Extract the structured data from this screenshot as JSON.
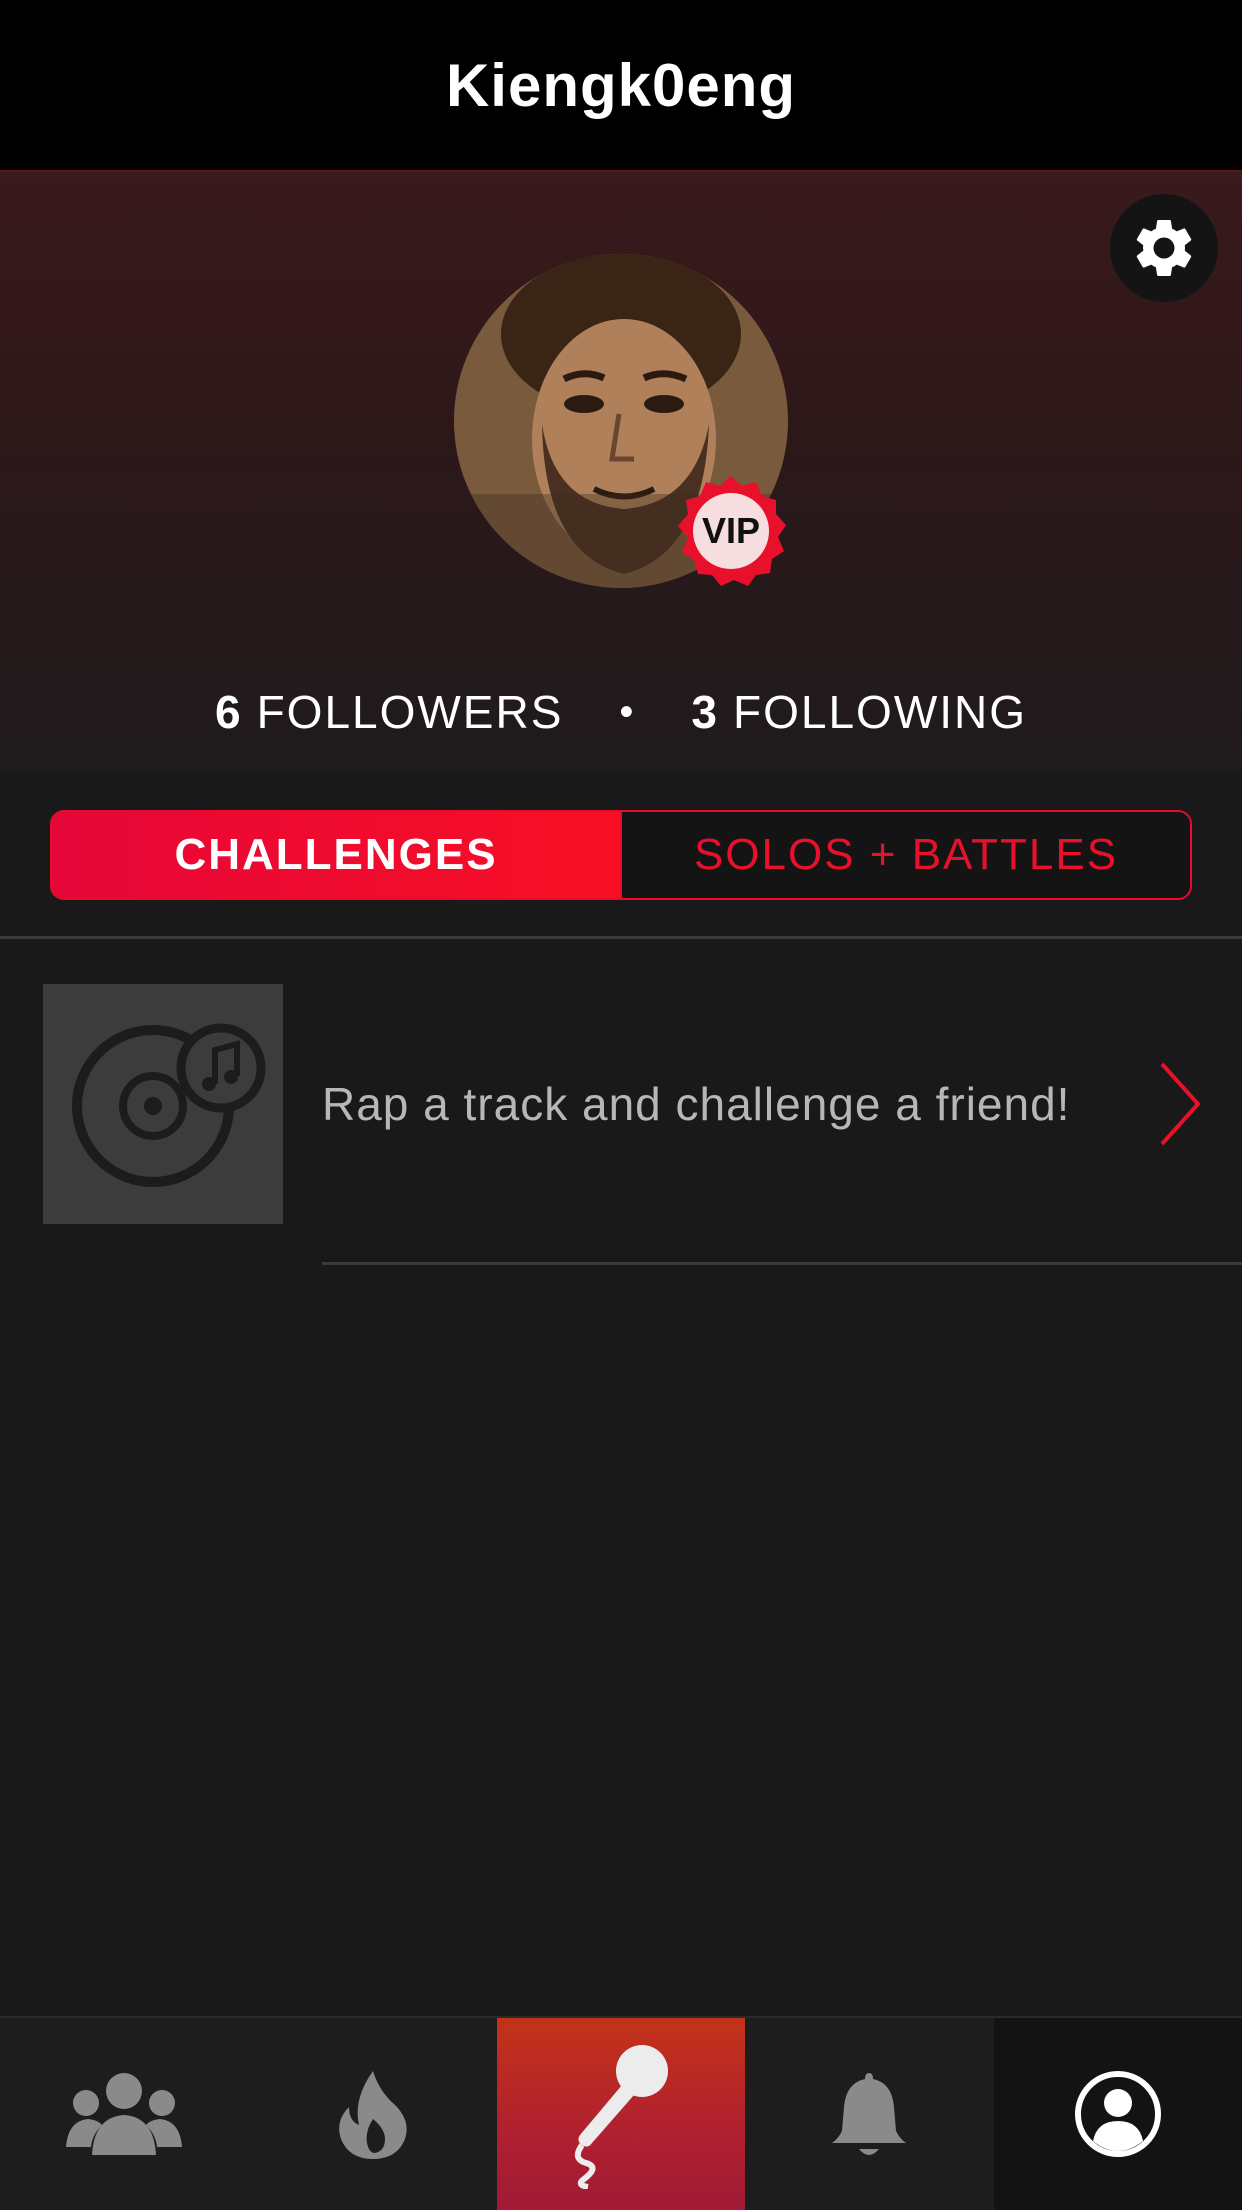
{
  "header": {
    "title": "Kiengk0eng"
  },
  "profile": {
    "badge": "VIP",
    "followers_count": "6",
    "followers_label": "FOLLOWERS",
    "separator": "•",
    "following_count": "3",
    "following_label": "FOLLOWING"
  },
  "tabs": [
    {
      "label": "CHALLENGES",
      "active": true
    },
    {
      "label": "SOLOS + BATTLES",
      "active": false
    }
  ],
  "list": [
    {
      "text": "Rap a track and challenge a friend!",
      "icon": "music-disc-icon"
    }
  ],
  "tabbar": [
    {
      "icon": "people-icon"
    },
    {
      "icon": "flame-icon"
    },
    {
      "icon": "microphone-icon"
    },
    {
      "icon": "bell-icon"
    },
    {
      "icon": "profile-icon",
      "active": true
    }
  ],
  "colors": {
    "accent": "#EA0A2A",
    "background": "#191919",
    "header": "#000000"
  }
}
